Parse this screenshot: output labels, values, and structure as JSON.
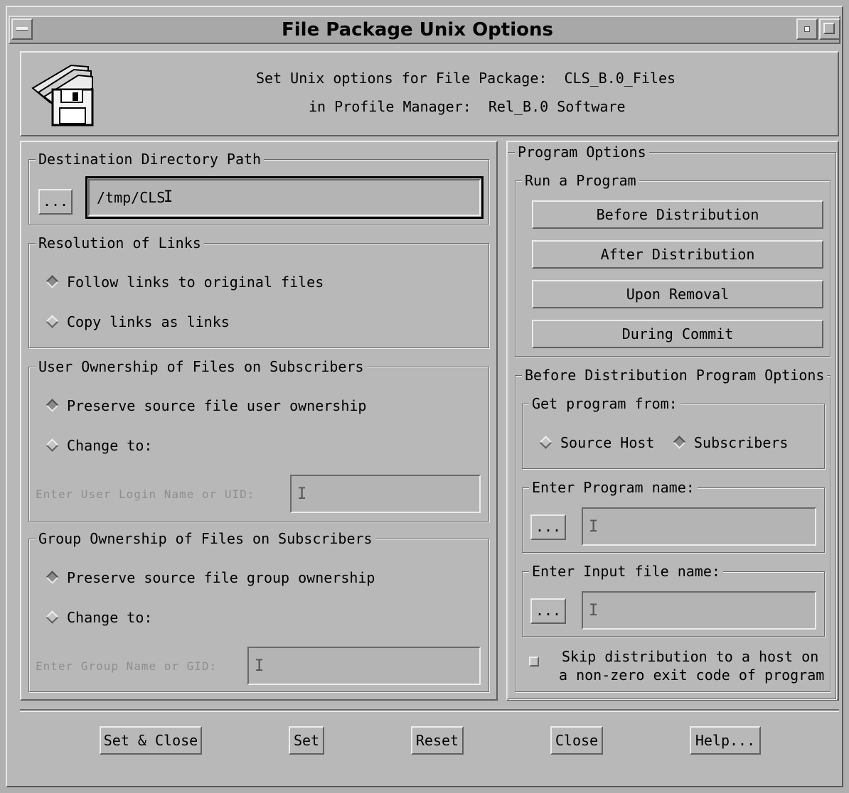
{
  "window": {
    "title": "File Package Unix Options"
  },
  "header": {
    "line1_label": "Set Unix options for File Package:",
    "line1_value": "CLS_B.0_Files",
    "line2_label": "in Profile Manager:",
    "line2_value": "Rel_B.0 Software",
    "icon": "floppy-folder-icon"
  },
  "destination": {
    "legend": "Destination Directory Path",
    "browse_label": "...",
    "path_value": "/tmp/CLS"
  },
  "links": {
    "legend": "Resolution of Links",
    "options": [
      {
        "label": "Follow links to original files",
        "selected": true
      },
      {
        "label": "Copy links as links",
        "selected": false
      }
    ]
  },
  "user_ownership": {
    "legend": "User Ownership of Files on Subscribers",
    "options": [
      {
        "label": "Preserve source file user ownership",
        "selected": true
      },
      {
        "label": "Change to:",
        "selected": false
      }
    ],
    "field_label": "Enter User Login Name or UID:",
    "field_value": ""
  },
  "group_ownership": {
    "legend": "Group Ownership of Files on Subscribers",
    "options": [
      {
        "label": "Preserve source file group ownership",
        "selected": true
      },
      {
        "label": "Change to:",
        "selected": false
      }
    ],
    "field_label": "Enter Group Name or GID:",
    "field_value": ""
  },
  "program_options": {
    "legend": "Program Options",
    "run_legend": "Run a Program",
    "run_buttons": [
      "Before Distribution",
      "After Distribution",
      "Upon Removal",
      "During Commit"
    ],
    "before_legend": "Before Distribution Program Options",
    "get_from_legend": "Get program from:",
    "get_from_options": [
      {
        "label": "Source Host",
        "selected": false
      },
      {
        "label": "Subscribers",
        "selected": true
      }
    ],
    "program_name_legend": "Enter Program name:",
    "program_browse_label": "...",
    "program_name_value": "",
    "input_file_legend": "Enter Input file name:",
    "input_browse_label": "...",
    "input_file_value": "",
    "skip_line1": "Skip distribution to a host on",
    "skip_line2": "a non-zero exit code of program",
    "skip_checked": false
  },
  "footer": {
    "buttons": [
      "Set & Close",
      "Set",
      "Reset",
      "Close",
      "Help..."
    ]
  }
}
